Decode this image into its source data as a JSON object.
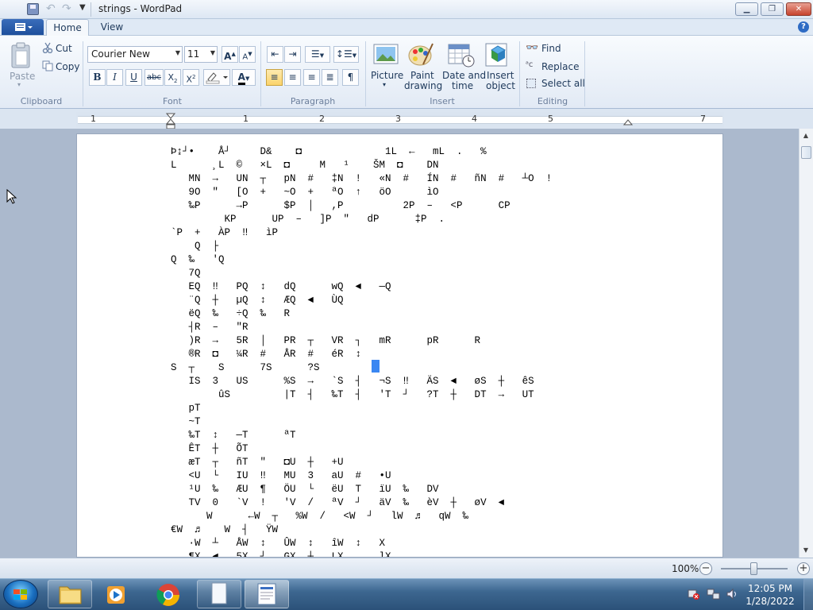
{
  "window": {
    "title": "strings - WordPad"
  },
  "tabs": {
    "home": "Home",
    "view": "View"
  },
  "clipboard": {
    "paste": "Paste",
    "cut": "Cut",
    "copy": "Copy",
    "group": "Clipboard"
  },
  "font": {
    "name": "Courier New",
    "size": "11",
    "group": "Font"
  },
  "paragraph": {
    "group": "Paragraph"
  },
  "insert": {
    "picture": "Picture",
    "paint1": "Paint",
    "paint2": "drawing",
    "datetime1": "Date and",
    "datetime2": "time",
    "object1": "Insert",
    "object2": "object",
    "group": "Insert"
  },
  "editing": {
    "find": "Find",
    "replace": "Replace",
    "select_all": "Select all",
    "group": "Editing"
  },
  "ruler": {
    "labels": [
      "1",
      "1",
      "2",
      "3",
      "4",
      "5",
      "7"
    ]
  },
  "document": {
    "lines": [
      "Þ↨┘•    Å┘     D&    ◘              1L  ←   mL  .   %",
      "L      ¸L  ©   ×L  ◘     M   ¹    ŠM  ◘    DN",
      "   MN  →   UN  ┬   pN  #   ‡N  !   «N  #   ÍN  #   ñN  #   ┴O  !",
      "   9O  \"   [O  +   ~O  +   ªO  ↑   öO      ìO",
      "   ‰P      →P      $P  │   ,P          2P  –   <P      CP",
      "         KP      UP  –   ]P  \"   dP      ‡P  .",
      "`P  +   ÀP  ‼   ìP",
      "    Q  ├",
      "Q  ‰   'Q",
      "   7Q",
      "   EQ  ‼   PQ  ↕   dQ      wQ  ◄   —Q",
      "   ¨Q  ┼   µQ  ↕   ÆQ  ◄   ÙQ",
      "   ëQ  ‰   ÷Q  ‰   R",
      "   ┤R  –   \"R",
      "   )R  →   5R  │   PR  ┬   VR  ┐   mR      pR      R",
      "   ®R  ◘   ¼R  #   ÅR  #   éR  ↕",
      "S  ┬    S      7S      ?S  ",
      "   IS  3   US      %S  →   `S  ┤   ¬S  ‼   ÄS  ◄   øS  ┼   êS",
      "        ûS         |T  ┤   ‰T  ┤   'T  ┘   ?T  ┼   DT  →   UT",
      "   pT",
      "   ~T",
      "   ‰T  ↕   —T      ªT",
      "   ÊT  ┼   ÕT",
      "   æT  ┬   ñT  \"   ◘U  ┼   +U",
      "   <U  └   IU  ‼   MU  3   aU  #   •U",
      "   ¹U  ‰   ÆU  ¶   ÖU  └   ëU  T   ïU  ‰   DV",
      "   TV  0   `V  !   'V  /   ªV  ┘   äV  ‰   èV  ┼   øV  ◄",
      "      W      ←W  ┬   %W  /   <W  ┘   lW  ♬   qW  ‰",
      "€W  ♬    W  ┤   ŸW",
      "   ·W  ┴   ÅW  ↕   ÛW  ↕   îW  ↕   X",
      "   ¶X  ◄   5X  ┘   GX  ┼   LX      lX"
    ]
  },
  "status": {
    "zoom": "100%"
  },
  "taskbar": {
    "time": "12:05 PM",
    "date": "1/28/2022"
  }
}
